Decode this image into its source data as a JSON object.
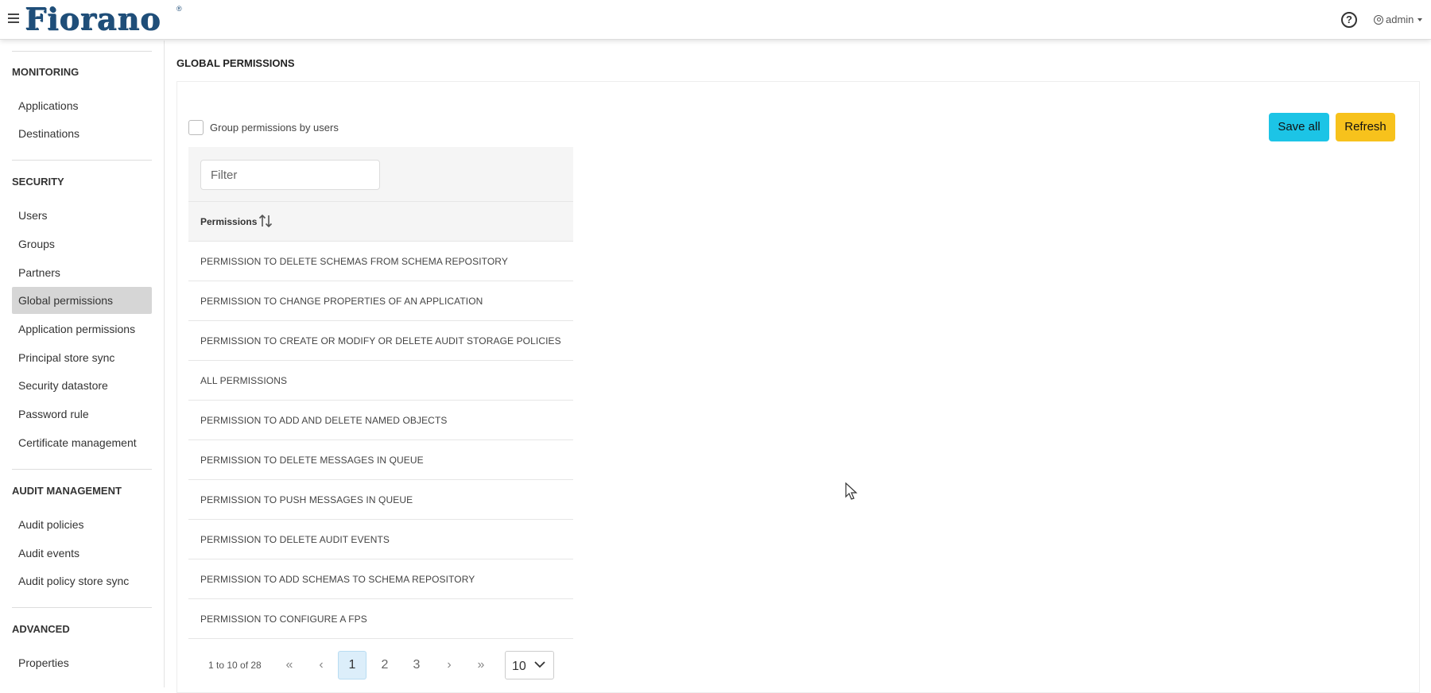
{
  "header": {
    "logo": "Fiorano",
    "logo_reg": "®",
    "help_glyph": "?",
    "user": "admin"
  },
  "sidebar": {
    "sections": [
      {
        "title": "MONITORING",
        "items": [
          "Applications",
          "Destinations"
        ]
      },
      {
        "title": "SECURITY",
        "items": [
          "Users",
          "Groups",
          "Partners",
          "Global permissions",
          "Application permissions",
          "Principal store sync",
          "Security datastore",
          "Password rule",
          "Certificate management"
        ]
      },
      {
        "title": "AUDIT MANAGEMENT",
        "items": [
          "Audit policies",
          "Audit events",
          "Audit policy store sync"
        ]
      },
      {
        "title": "ADVANCED",
        "items": [
          "Properties"
        ]
      }
    ],
    "active_item": "Global permissions"
  },
  "main": {
    "title": "GLOBAL PERMISSIONS",
    "group_by_users_label": "Group permissions by users",
    "group_by_users_checked": false,
    "save_all_label": "Save all",
    "refresh_label": "Refresh",
    "filter_placeholder": "Filter",
    "column_header": "Permissions",
    "rows": [
      "PERMISSION TO DELETE SCHEMAS FROM SCHEMA REPOSITORY",
      "PERMISSION TO CHANGE PROPERTIES OF AN APPLICATION",
      "PERMISSION TO CREATE OR MODIFY OR DELETE AUDIT STORAGE POLICIES",
      "ALL PERMISSIONS",
      "PERMISSION TO ADD AND DELETE NAMED OBJECTS",
      "PERMISSION TO DELETE MESSAGES IN QUEUE",
      "PERMISSION TO PUSH MESSAGES IN QUEUE",
      "PERMISSION TO DELETE AUDIT EVENTS",
      "PERMISSION TO ADD SCHEMAS TO SCHEMA REPOSITORY",
      "PERMISSION TO CONFIGURE A FPS"
    ],
    "pager": {
      "summary": "1 to 10 of 28",
      "pages": [
        "1",
        "2",
        "3"
      ],
      "current_page": "1",
      "page_size": "10"
    }
  },
  "colors": {
    "save_all": "#1cc4e6",
    "refresh": "#f7c21c",
    "active_sidebar": "#d6d6d6",
    "logo": "#1f4e79"
  }
}
